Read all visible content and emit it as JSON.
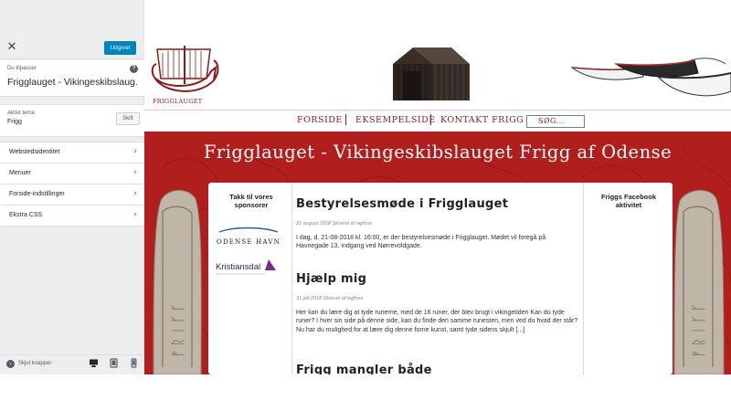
{
  "customizer": {
    "close_icon": "close-icon",
    "publish_label": "Udgivet",
    "customizing_label": "Du tilpasser",
    "site_title": "Frigglauget - Vikingeskibslaug…",
    "help_icon": "help-icon",
    "active_theme_caption": "Aktivt tema",
    "active_theme_name": "Frigg",
    "change_theme_label": "Skift",
    "panels": [
      {
        "label": "Webstedsidentitet"
      },
      {
        "label": "Menuer"
      },
      {
        "label": "Forside-indstillinger"
      },
      {
        "label": "Ekstra CSS"
      }
    ],
    "footer": {
      "hide_controls_label": "Skjul knapper",
      "devices": [
        "desktop-icon",
        "tablet-icon",
        "mobile-icon"
      ]
    },
    "accent_color": "#0085ba"
  },
  "site": {
    "logo_text": "FRIGGLAUGET",
    "nav": {
      "items": [
        {
          "label": "FORSIDE"
        },
        {
          "label": "EKSEMPELSIDE"
        },
        {
          "label": "KONTAKT FRIGG"
        }
      ],
      "search_placeholder": "SØG..."
    },
    "title": "Frigglauget - Vikingeskibslauget Frigg af Odense",
    "sidebar_left": {
      "title": "Takk til vores sponsorer",
      "sponsors": [
        {
          "name": "ODENSE HAVN"
        },
        {
          "name": "Kristiansdal"
        }
      ]
    },
    "sidebar_right": {
      "title": "Friggs Facebook aktivitet"
    },
    "posts": [
      {
        "title": "Bestyrelsesmøde i Frigglauget",
        "meta": "21 august 2018 Skrevet af lagfoss",
        "excerpt": "I dag, d. 21-08-2018 kl. 16:00, er der bestyrelsesmøde i Frigglauget. Mødet vil foregå på Havnegade 13, indgang ved Nørrevoldgade."
      },
      {
        "title": "Hjælp mig",
        "meta": "31 juli 2018 Skrevet af lagfoss",
        "excerpt": "Her kan du lære dig at tyde runerne, med de 16 runer, der blev brugt i vikingetiden Kan du tyde runer? I hver sin side på denne side, kan du finde den samme runesten, men ved du hvad der står? Nu har du mulighed for at lære dig denne forne kunst, samt tyde sidens skjult [...]"
      },
      {
        "title": "Frigg mangler både"
      }
    ],
    "brand_color": "#8b1a1a",
    "banner_color": "#b01e1e"
  }
}
